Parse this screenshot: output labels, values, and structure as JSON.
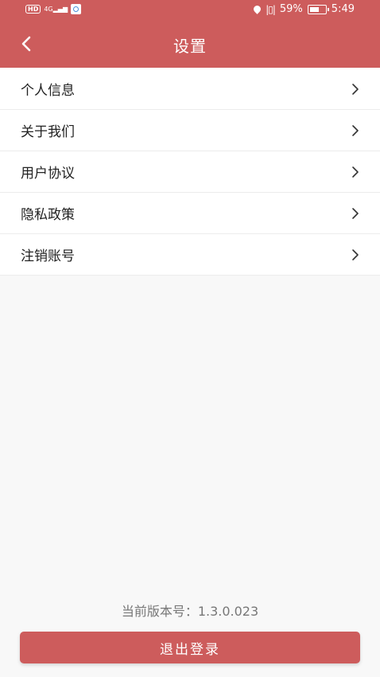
{
  "status_bar": {
    "left_badge": "HD",
    "network": "4G",
    "battery": "59%",
    "time": "5:49"
  },
  "header": {
    "title": "设置",
    "back_icon": "chevron-left-icon"
  },
  "menu": {
    "items": [
      {
        "label": "个人信息"
      },
      {
        "label": "关于我们"
      },
      {
        "label": "用户协议"
      },
      {
        "label": "隐私政策"
      },
      {
        "label": "注销账号"
      }
    ]
  },
  "footer": {
    "version_text": "当前版本号：1.3.0.023",
    "logout_label": "退出登录"
  },
  "colors": {
    "accent": "#cd5c5c",
    "background": "#f8f8f8"
  }
}
